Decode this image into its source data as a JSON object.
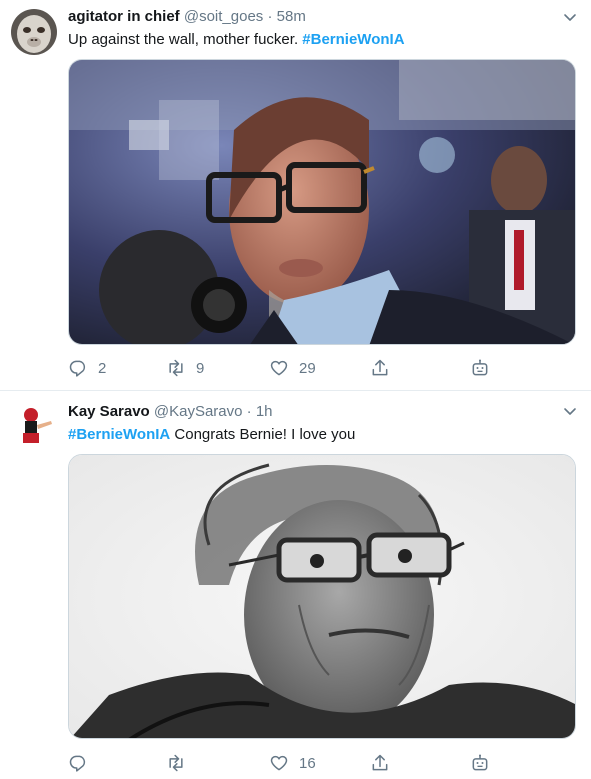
{
  "tweets": [
    {
      "name": "agitator in chief",
      "handle": "@soit_goes",
      "dot": "·",
      "time": "58m",
      "text_before": "Up against the wall, mother fucker. ",
      "hashtag": "#BernieWonIA",
      "text_after": "",
      "replies": "2",
      "retweets": "9",
      "likes": "29"
    },
    {
      "name": "Kay Saravo",
      "handle": "@KaySaravo",
      "dot": "·",
      "time": "1h",
      "text_before": "",
      "hashtag": "#BernieWonIA",
      "text_after": " Congrats Bernie! I love you",
      "replies": "",
      "retweets": "",
      "likes": "16"
    }
  ],
  "icons": {
    "reply": "reply-icon",
    "retweet": "retweet-icon",
    "like": "heart-icon",
    "share": "share-icon",
    "bot": "robot-icon",
    "caret": "chevron-down-icon"
  },
  "colors": {
    "text": "#14171a",
    "secondary": "#657786",
    "link": "#1da1f2",
    "divider": "#e6ecf0"
  }
}
